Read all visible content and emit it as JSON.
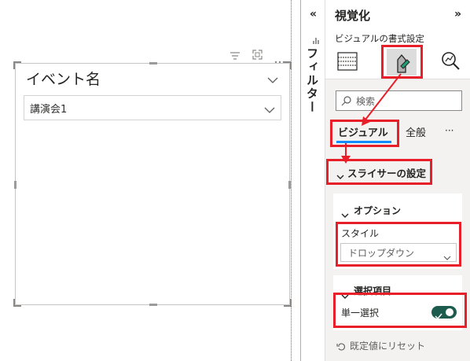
{
  "canvas": {
    "slicer": {
      "title": "イベント名",
      "selected_value": "講演会1"
    },
    "visual_header_icons": [
      "filter-icon",
      "focus-mode-icon",
      "more-options-icon"
    ]
  },
  "filter_pane": {
    "label": "フィルター",
    "collapse_icon": "double-chevron-left-icon"
  },
  "viz_pane": {
    "title": "視覚化",
    "expand_icon": "double-chevron-right-icon",
    "subtitle": "ビジュアルの書式設定",
    "type_icons": [
      "build-visual-icon",
      "format-visual-icon",
      "analytics-icon"
    ],
    "search_placeholder": "検索",
    "tabs": [
      {
        "label": "ビジュアル",
        "active": true
      },
      {
        "label": "全般",
        "active": false
      }
    ],
    "tabs_more": "···",
    "sections": {
      "slicer_settings": "スライサーの設定",
      "options": "オプション",
      "style_label": "スタイル",
      "style_value": "ドロップダウン",
      "selection": "選択項目",
      "single_select": "単一選択",
      "single_select_on": true
    },
    "reset_label": "既定値にリセット"
  },
  "annotations": {
    "highlight_color": "#e81e28",
    "accent_color": "#118dff",
    "toggle_color": "#1e5b4f"
  }
}
